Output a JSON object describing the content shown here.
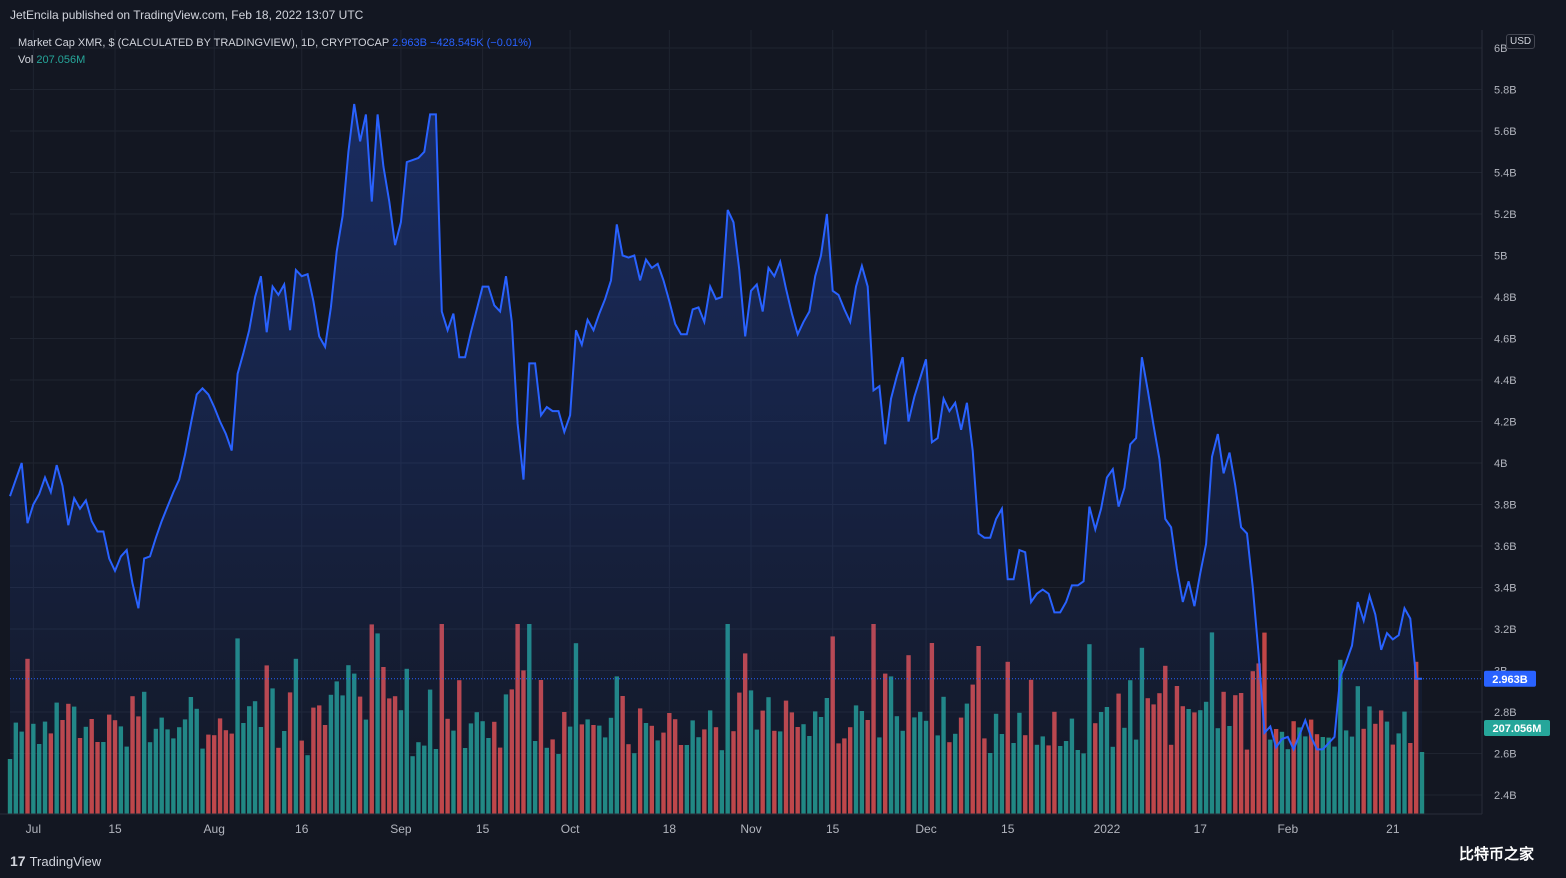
{
  "header": {
    "publisher": "JetEncila published on TradingView.com, Feb 18, 2022 13:07 UTC"
  },
  "legend": {
    "title": "Market Cap XMR, $ (CALCULATED BY TRADINGVIEW), 1D, CRYPTOCAP",
    "last_value": "2.963B",
    "change": "−428.545K (−0.01%)",
    "vol_label": "Vol",
    "vol_value": "207.056M"
  },
  "price_axis": {
    "currency_button": "USD",
    "tick_labels": [
      "6B",
      "5.8B",
      "5.6B",
      "5.4B",
      "5.2B",
      "5B",
      "4.8B",
      "4.6B",
      "4.4B",
      "4.2B",
      "4B",
      "3.8B",
      "3.6B",
      "3.4B",
      "3.2B",
      "3B",
      "2.8B",
      "2.6B",
      "2.4B"
    ],
    "last_price_tag": "2.963B",
    "last_volume_tag": "207.056M"
  },
  "time_axis": {
    "tick_labels": [
      "Jul",
      "15",
      "Aug",
      "16",
      "Sep",
      "15",
      "Oct",
      "18",
      "Nov",
      "15",
      "Dec",
      "15",
      "2022",
      "17",
      "Feb",
      "21"
    ]
  },
  "footer": {
    "brand": "TradingView",
    "brand_mark": "17",
    "watermark": "比特币之家"
  },
  "colors": {
    "background": "#131722",
    "line": "#2962ff",
    "volume_up": "#26a69a",
    "volume_down": "#ef5350",
    "grid": "#1f2430"
  },
  "chart_data": {
    "type": "line",
    "title": "Market Cap XMR, $ (CALCULATED BY TRADINGVIEW), 1D, CRYPTOCAP",
    "xlabel": "",
    "ylabel": "",
    "ylim": [
      2.3,
      6.05
    ],
    "x_range": [
      "2021-06-27",
      "2022-02-18"
    ],
    "grid": true,
    "series": [
      {
        "values": [
          3.84,
          3.92,
          4.0,
          3.71,
          3.8,
          3.85,
          3.93,
          3.86,
          3.99,
          3.89,
          3.7,
          3.83,
          3.78,
          3.82,
          3.72,
          3.67,
          3.67,
          3.54,
          3.48,
          3.55,
          3.58,
          3.42,
          3.3,
          3.54,
          3.55,
          3.64,
          3.72,
          3.79,
          3.86,
          3.92,
          4.04,
          4.19,
          4.33,
          4.36,
          4.33,
          4.27,
          4.2,
          4.14,
          4.06,
          4.43,
          4.53,
          4.64,
          4.8,
          4.9,
          4.63,
          4.85,
          4.81,
          4.86,
          4.64,
          4.93,
          4.9,
          4.91,
          4.78,
          4.61,
          4.56,
          4.75,
          5.02,
          5.19,
          5.5,
          5.73,
          5.55,
          5.68,
          5.26,
          5.68,
          5.43,
          5.26,
          5.05,
          5.16,
          5.45,
          5.46,
          5.47,
          5.5,
          5.68,
          5.68,
          4.73,
          4.64,
          4.72,
          4.51,
          4.51,
          4.63,
          4.74,
          4.85,
          4.85,
          4.76,
          4.73,
          4.9,
          4.68,
          4.19,
          3.92,
          4.48,
          4.48,
          4.23,
          4.27,
          4.25,
          4.25,
          4.15,
          4.23,
          4.64,
          4.57,
          4.69,
          4.64,
          4.72,
          4.79,
          4.88,
          5.15,
          5.0,
          4.99,
          5.0,
          4.88,
          4.98,
          4.94,
          4.96,
          4.88,
          4.78,
          4.67,
          4.62,
          4.62,
          4.74,
          4.75,
          4.68,
          4.85,
          4.79,
          4.8,
          5.22,
          5.16,
          4.93,
          4.61,
          4.83,
          4.86,
          4.73,
          4.94,
          4.9,
          4.97,
          4.84,
          4.72,
          4.62,
          4.68,
          4.73,
          4.9,
          5.0,
          5.2,
          4.83,
          4.81,
          4.74,
          4.68,
          4.85,
          4.95,
          4.85,
          4.35,
          4.37,
          4.09,
          4.31,
          4.42,
          4.51,
          4.2,
          4.32,
          4.41,
          4.5,
          4.1,
          4.12,
          4.31,
          4.25,
          4.29,
          4.16,
          4.29,
          4.06,
          3.66,
          3.64,
          3.64,
          3.73,
          3.78,
          3.44,
          3.44,
          3.58,
          3.57,
          3.33,
          3.37,
          3.39,
          3.37,
          3.28,
          3.28,
          3.33,
          3.41,
          3.41,
          3.43,
          3.79,
          3.68,
          3.78,
          3.93,
          3.97,
          3.79,
          3.88,
          4.09,
          4.12,
          4.51,
          4.35,
          4.18,
          4.02,
          3.73,
          3.69,
          3.49,
          3.33,
          3.43,
          3.31,
          3.47,
          3.61,
          4.03,
          4.14,
          3.95,
          4.05,
          3.89,
          3.69,
          3.66,
          3.4,
          3.08,
          2.7,
          2.73,
          2.63,
          2.67,
          2.68,
          2.62,
          2.69,
          2.76,
          2.68,
          2.62,
          2.62,
          2.65,
          2.68,
          2.97,
          3.04,
          3.12,
          3.33,
          3.24,
          3.36,
          3.27,
          3.1,
          3.18,
          3.15,
          3.17,
          3.3,
          3.25,
          2.96,
          2.96
        ]
      }
    ],
    "volume": {
      "name": "Vol",
      "last": "207.056M"
    }
  }
}
